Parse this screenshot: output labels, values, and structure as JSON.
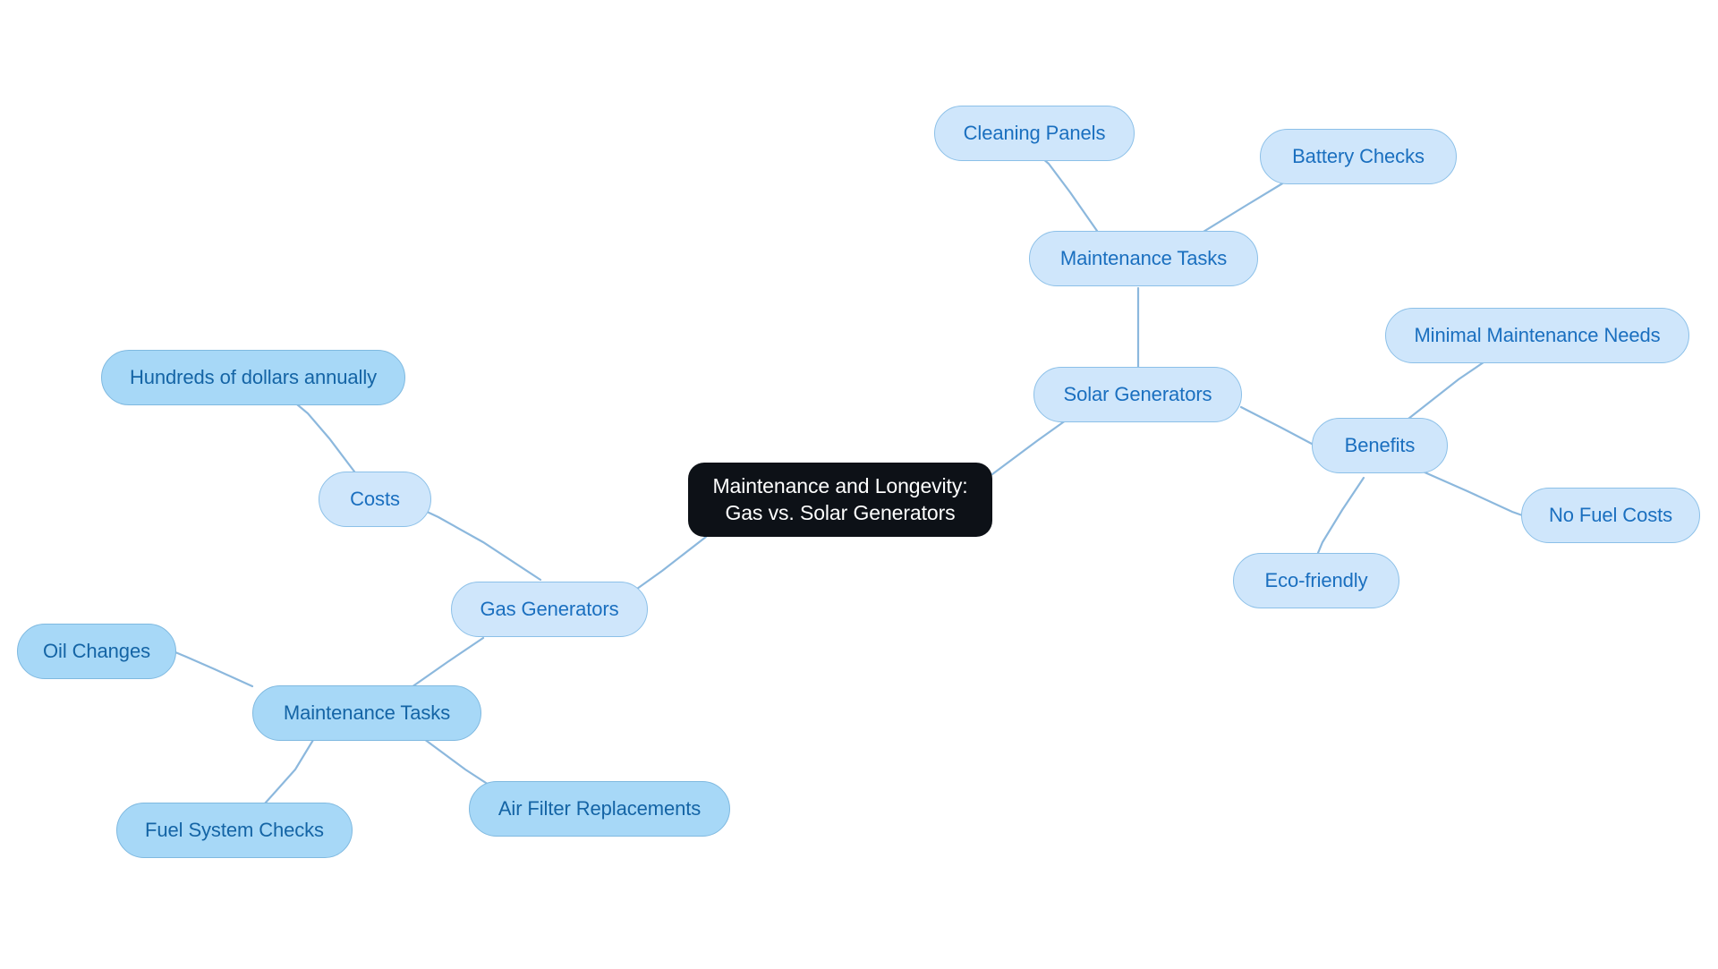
{
  "diagram": {
    "type": "mindmap",
    "title": "Maintenance and Longevity: Gas vs. Solar Generators",
    "background_color": "#ffffff",
    "edge_color": "#8cb8dd",
    "root_fill": "#0d1117",
    "root_text_color": "#ffffff",
    "branch_fill": "#cfe6fb",
    "branch_text_color": "#1a6fbf",
    "leaf_fill": "#a7d8f7",
    "leaf_text_color": "#1464a5"
  },
  "nodes": {
    "root": {
      "line1": "Maintenance and Longevity:",
      "line2": "Gas vs. Solar Generators"
    },
    "solar_generators": {
      "label": "Solar Generators"
    },
    "solar_maintenance_tasks": {
      "label": "Maintenance Tasks"
    },
    "cleaning_panels": {
      "label": "Cleaning Panels"
    },
    "battery_checks": {
      "label": "Battery Checks"
    },
    "benefits": {
      "label": "Benefits"
    },
    "minimal_maintenance_needs": {
      "label": "Minimal Maintenance Needs"
    },
    "no_fuel_costs": {
      "label": "No Fuel Costs"
    },
    "eco_friendly": {
      "label": "Eco-friendly"
    },
    "gas_generators": {
      "label": "Gas Generators"
    },
    "costs": {
      "label": "Costs"
    },
    "hundreds_of_dollars": {
      "label": "Hundreds of dollars annually"
    },
    "gas_maintenance_tasks": {
      "label": "Maintenance Tasks"
    },
    "oil_changes": {
      "label": "Oil Changes"
    },
    "fuel_system_checks": {
      "label": "Fuel System Checks"
    },
    "air_filter_replacements": {
      "label": "Air Filter Replacements"
    }
  },
  "structure": {
    "root_children": [
      "Solar Generators",
      "Gas Generators"
    ],
    "solar_children": [
      "Maintenance Tasks",
      "Benefits"
    ],
    "solar_maintenance_children": [
      "Cleaning Panels",
      "Battery Checks"
    ],
    "benefits_children": [
      "Minimal Maintenance Needs",
      "No Fuel Costs",
      "Eco-friendly"
    ],
    "gas_children": [
      "Costs",
      "Maintenance Tasks"
    ],
    "costs_children": [
      "Hundreds of dollars annually"
    ],
    "gas_maintenance_children": [
      "Oil Changes",
      "Fuel System Checks",
      "Air Filter Replacements"
    ]
  }
}
